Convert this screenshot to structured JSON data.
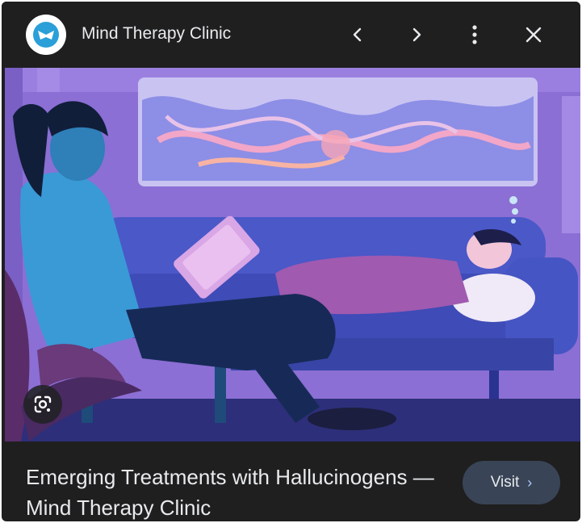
{
  "header": {
    "site_name": "Mind Therapy Clinic",
    "logo_icon": "chat-bubble-logo",
    "prev_icon": "chevron-left-icon",
    "next_icon": "chevron-right-icon",
    "more_icon": "more-vert-icon",
    "close_icon": "close-icon"
  },
  "image": {
    "subject": "illustration",
    "lens_icon": "google-lens-icon"
  },
  "footer": {
    "title": "Emerging Treatments with Hallucinogens — Mind Therapy Clinic",
    "visit_label": "Visit",
    "visit_chevron": "›"
  },
  "colors": {
    "panel_bg": "#1f1f1f",
    "text": "#e8eaed",
    "visit_bg": "#394457",
    "accent": "#1a73e8"
  }
}
